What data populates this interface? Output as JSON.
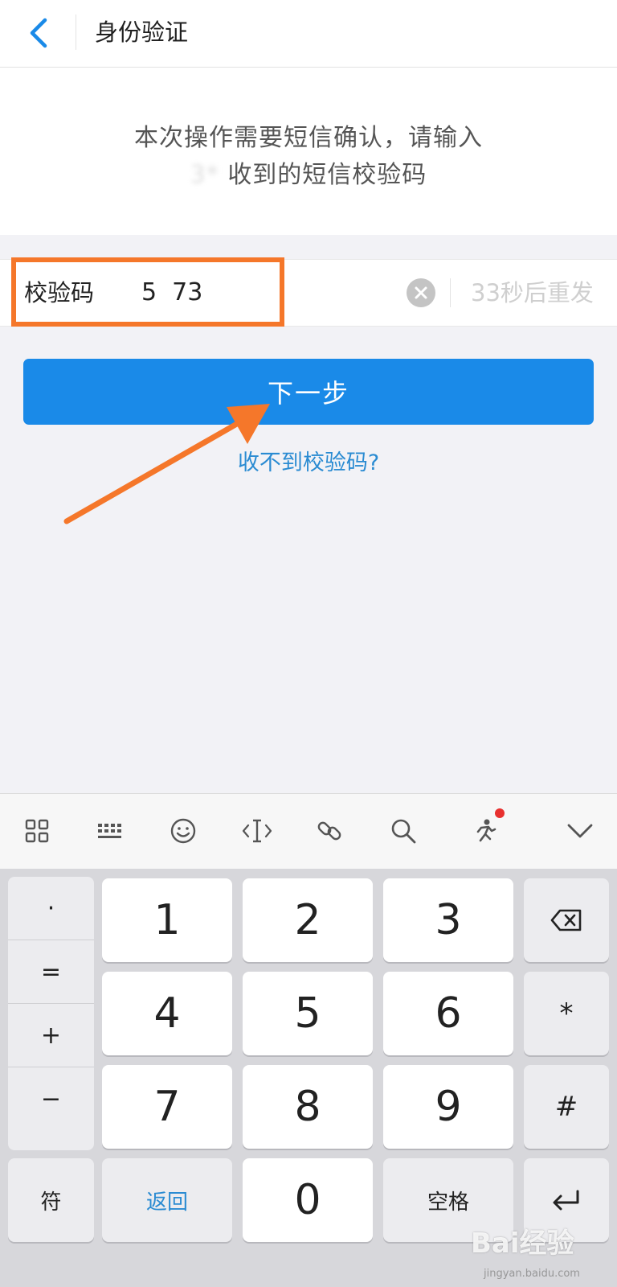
{
  "header": {
    "title": "身份验证"
  },
  "notice": {
    "line1": "本次操作需要短信确认，请输入",
    "phone_masked": "3*",
    "line2_suffix": "收到的短信校验码"
  },
  "code_field": {
    "label": "校验码",
    "value": "5  73",
    "resend_text": "33秒后重发"
  },
  "next_button": {
    "label": "下一步"
  },
  "help_link": {
    "label": "收不到校验码?"
  },
  "keyboard": {
    "symbols": [
      "·",
      "=",
      "+",
      "−"
    ],
    "digits": [
      "1",
      "2",
      "3",
      "4",
      "5",
      "6",
      "7",
      "8",
      "9",
      "0"
    ],
    "right_keys": [
      "*",
      "#"
    ],
    "fn_key": "符",
    "back_key": "返回",
    "space_key": "空格"
  },
  "watermark": {
    "text": "Bai经验",
    "url": "jingyan.baidu.com"
  },
  "colors": {
    "accent": "#1a8ae8",
    "link": "#2a8bd2",
    "annotation": "#f5772a",
    "notification_dot": "#e8312f"
  },
  "icons": [
    "chevron-left-icon",
    "clear-icon",
    "grid-icon",
    "keyboard-icon",
    "emoji-icon",
    "text-cursor-icon",
    "link-icon",
    "search-icon",
    "runner-icon",
    "chevron-down-icon",
    "backspace-icon",
    "enter-icon"
  ]
}
